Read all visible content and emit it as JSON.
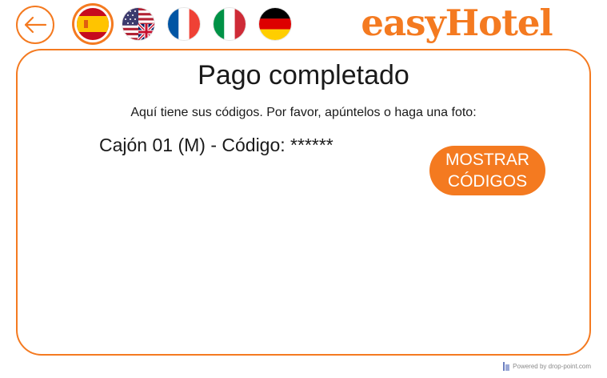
{
  "header": {
    "brand": "easyHotel",
    "languages": [
      {
        "code": "es",
        "icon": "spain-flag-icon",
        "selected": true
      },
      {
        "code": "en",
        "icon": "uk-us-flag-icon",
        "selected": false
      },
      {
        "code": "fr",
        "icon": "france-flag-icon",
        "selected": false
      },
      {
        "code": "it",
        "icon": "italy-flag-icon",
        "selected": false
      },
      {
        "code": "de",
        "icon": "germany-flag-icon",
        "selected": false
      }
    ]
  },
  "main": {
    "title": "Pago completado",
    "subtitle": "Aquí tiene sus códigos. Por favor, apúntelos o haga una foto:",
    "code_line": "Cajón 01 (M) - Código: ******",
    "show_button": {
      "line1": "MOSTRAR",
      "line2": "CÓDIGOS"
    }
  },
  "footer": {
    "powered_by": "Powered by drop-point.com"
  },
  "colors": {
    "accent": "#f47a20",
    "text": "#1a1a1a",
    "background": "#ffffff"
  }
}
